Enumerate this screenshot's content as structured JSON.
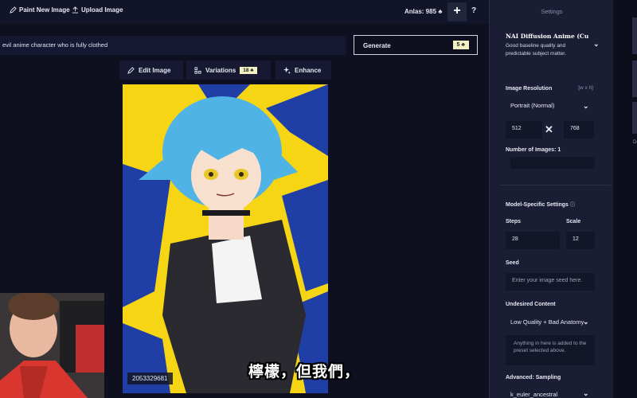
{
  "topbar": {
    "paint_label": "Paint New Image",
    "upload_label": "Upload Image",
    "anlas": "Anlas: 985",
    "add_label": "+",
    "help_label": "?"
  },
  "prompt": {
    "value": "evil anime character who is fully clothed"
  },
  "generate": {
    "label": "Generate",
    "cost": "5"
  },
  "actions": {
    "edit_label": "Edit Image",
    "variations_label": "Variations",
    "variations_cost": "18",
    "enhance_label": "Enhance"
  },
  "image": {
    "seed": "2053329681"
  },
  "subtitle": "檸檬，但我們，",
  "settings": {
    "title": "Settings",
    "model_name": "NAI Diffusion Anime (Curated)",
    "model_desc": "Good baseline quality and predictable subject matter.",
    "resolution_label": "Image Resolution",
    "resolution_dims": "[w x h]",
    "resolution_value": "Portrait (Normal)",
    "width": "512",
    "height": "768",
    "num_images_label": "Number of Images: 1",
    "model_specific_label": "Model-Specific Settings",
    "steps_label": "Steps",
    "steps_value": "28",
    "scale_label": "Scale",
    "scale_value": "12",
    "seed_label": "Seed",
    "seed_placeholder": "Enter your image seed here.",
    "undesired_label": "Undesired Content",
    "undesired_value": "Low Quality + Bad Anatomy",
    "undesired_placeholder": "Anything in here is added to the preset selected above.",
    "sampling_label": "Advanced: Sampling",
    "sampling_value": "k_euler_ancestral"
  },
  "right_edge": {
    "text": "De"
  },
  "colors": {
    "background": "#0e1020",
    "panel": "#1a1d33",
    "badge": "#f3f0c4",
    "image_yellow": "#f5d514",
    "image_blue": "#1f3fa6",
    "hair_blue": "#4fb3e6"
  }
}
